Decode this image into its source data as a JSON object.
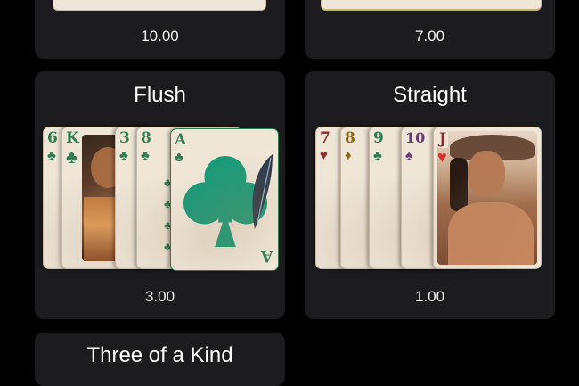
{
  "top_left": {
    "value": "10.00"
  },
  "top_right": {
    "value": "7.00"
  },
  "flush": {
    "title": "Flush",
    "value": "3.00",
    "cards": [
      {
        "rank": "6",
        "suit": "♣",
        "color": "#2f7d4f"
      },
      {
        "rank": "K",
        "suit": "♣",
        "color": "#2f7d4f"
      },
      {
        "rank": "3",
        "suit": "♣",
        "color": "#2f7d4f"
      },
      {
        "rank": "8",
        "suit": "♣",
        "color": "#2f7d4f"
      },
      {
        "rank": "A",
        "suit": "♣",
        "color": "#2f7d4f"
      }
    ]
  },
  "straight": {
    "title": "Straight",
    "value": "1.00",
    "cards": [
      {
        "rank": "7",
        "suit": "♥",
        "color": "#8b2a2a"
      },
      {
        "rank": "8",
        "suit": "♦",
        "color": "#8a6a1a"
      },
      {
        "rank": "9",
        "suit": "♣",
        "color": "#2f7d4f"
      },
      {
        "rank": "10",
        "suit": "♠",
        "color": "#6b3a7a"
      },
      {
        "rank": "J",
        "suit": "♥",
        "color": "#8b2a2a"
      }
    ]
  },
  "bottom_left": {
    "title": "Three of a Kind"
  },
  "colors": {
    "background": "#000000",
    "panel": "#1c1c1e",
    "card_face": "#efe6d8",
    "club_teal": "#1a9a78"
  },
  "icons": [
    "club-suit-icon",
    "heart-suit-icon",
    "diamond-suit-icon",
    "spade-suit-icon",
    "feather-icon"
  ]
}
